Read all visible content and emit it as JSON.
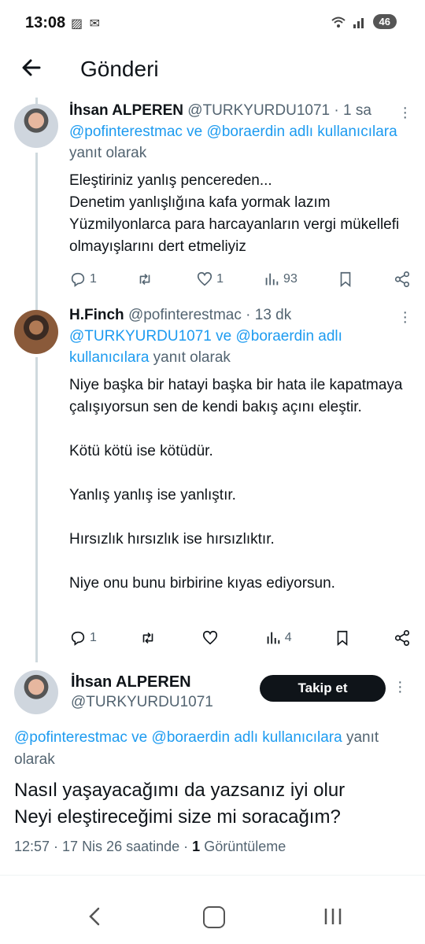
{
  "status_bar": {
    "time": "13:08",
    "battery": "46",
    "left_icons": [
      "gallery-icon",
      "message-icon"
    ],
    "right_icons": [
      "wifi-icon",
      "signal-icon"
    ]
  },
  "header": {
    "title": "Gönderi",
    "back_icon": "arrow-left-icon"
  },
  "tweets": [
    {
      "name": "İhsan ALPEREN",
      "handle": "@TURKYURDU1071",
      "time": "· 1 sa",
      "reply_links": "@pofinterestmac ve @boraerdin adlı kullanıcılara",
      "reply_suffix": "yanıt olarak",
      "body": "Eleştiriniz yanlış pencereden...\nDenetim yanlışlığına kafa yormak lazım\nYüzmilyonlarca para harcayanların vergi mükellefi olmayışlarını dert etmeliyiz",
      "replies": "1",
      "retweets": "",
      "likes": "1",
      "views": "93"
    },
    {
      "name": "H.Finch",
      "handle": "@pofinterestmac",
      "time": "· 13 dk",
      "reply_links": "@TURKYURDU1071 ve @boraerdin adlı kullanıcılara",
      "reply_suffix": "yanıt olarak",
      "body": "Niye başka bir hatayi başka bir hata ile kapatmaya çalışıyorsun sen de kendi bakış açını eleştir.\n\nKötü kötü ise kötüdür.\n\nYanlış yanlış ise yanlıştır.\n\nHırsızlık hırsızlık ise hırsızlıktır.\n\nNiye onu bunu birbirine kıyas ediyorsun.",
      "replies": "1",
      "retweets": "",
      "likes": "",
      "views": "4"
    }
  ],
  "focus": {
    "name": "İhsan ALPEREN",
    "handle": "@TURKYURDU1071",
    "follow_label": "Takip et",
    "reply_links": "@pofinterestmac ve @boraerdin adlı kullanıcılara",
    "reply_suffix": "yanıt olarak",
    "body": "Nasıl yaşayacağımı da yazsanız iyi olur\nNeyi eleştireceğimi size mi soracağım?",
    "date": "12:57 · 17 Nis 26 saatinde ·",
    "views_count": "1",
    "views_label": "Görüntüleme"
  },
  "nav": {
    "icons": [
      "back-nav-icon",
      "home-nav-icon",
      "recents-nav-icon"
    ]
  }
}
